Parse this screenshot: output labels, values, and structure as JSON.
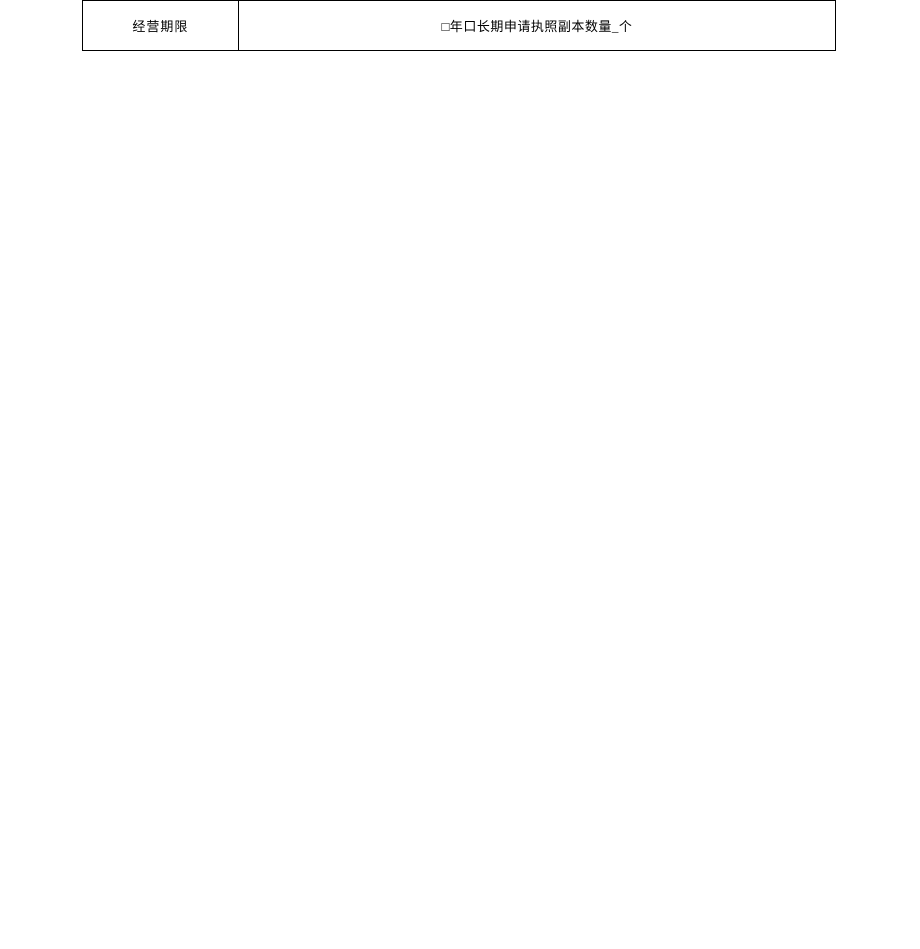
{
  "row": {
    "label": "经营期限",
    "checkbox1": "□",
    "text1": "年",
    "checkbox2": "口",
    "text2": "长期申请执照副本数量_个"
  }
}
